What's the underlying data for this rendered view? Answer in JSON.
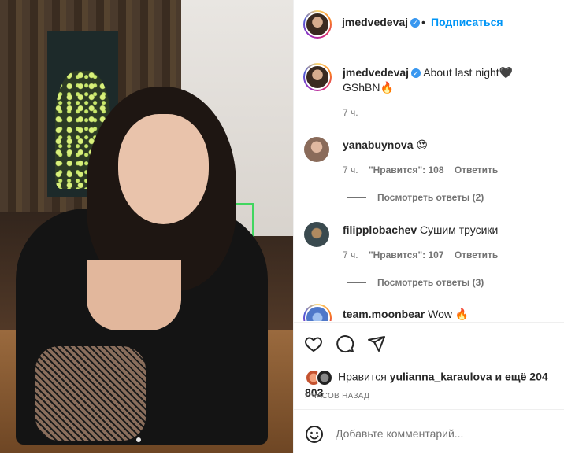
{
  "header": {
    "username": "jmedvedevaj",
    "separator": "•",
    "follow_label": "Подписаться"
  },
  "caption": {
    "username": "jmedvedevaj",
    "text": "About last night🖤",
    "text2": "GShBN🔥",
    "time": "7 ч."
  },
  "comments": [
    {
      "username": "yanabuynova",
      "text": "😍",
      "time": "7 ч.",
      "likes": "\"Нравится\": 108",
      "reply": "Ответить",
      "view_replies": "Посмотреть ответы (2)",
      "avatar_color": "#8a6b5a"
    },
    {
      "username": "filipplobachev",
      "text": "Сушим трусики",
      "time": "7 ч.",
      "likes": "\"Нравится\": 107",
      "reply": "Ответить",
      "view_replies": "Посмотреть ответы (3)",
      "avatar_color": "#3a4a4f"
    },
    {
      "username": "team.moonbear",
      "text": "Wow 🔥",
      "avatar_color": "#4f78c9"
    }
  ],
  "actions": {
    "liked_by_prefix": "Нравится ",
    "liked_by_user": "yulianna_karaulova",
    "liked_by_suffix": " и ещё 204 803",
    "time_ago": "7 ЧАСОВ НАЗАД",
    "icons": [
      "heart-icon",
      "comment-icon",
      "share-icon",
      "bookmark-icon"
    ]
  },
  "add_comment": {
    "placeholder": "Добавьте комментарий..."
  },
  "colors": {
    "link": "#0095f6",
    "verified": "#3897f0",
    "muted": "#737373",
    "text": "#262626"
  }
}
